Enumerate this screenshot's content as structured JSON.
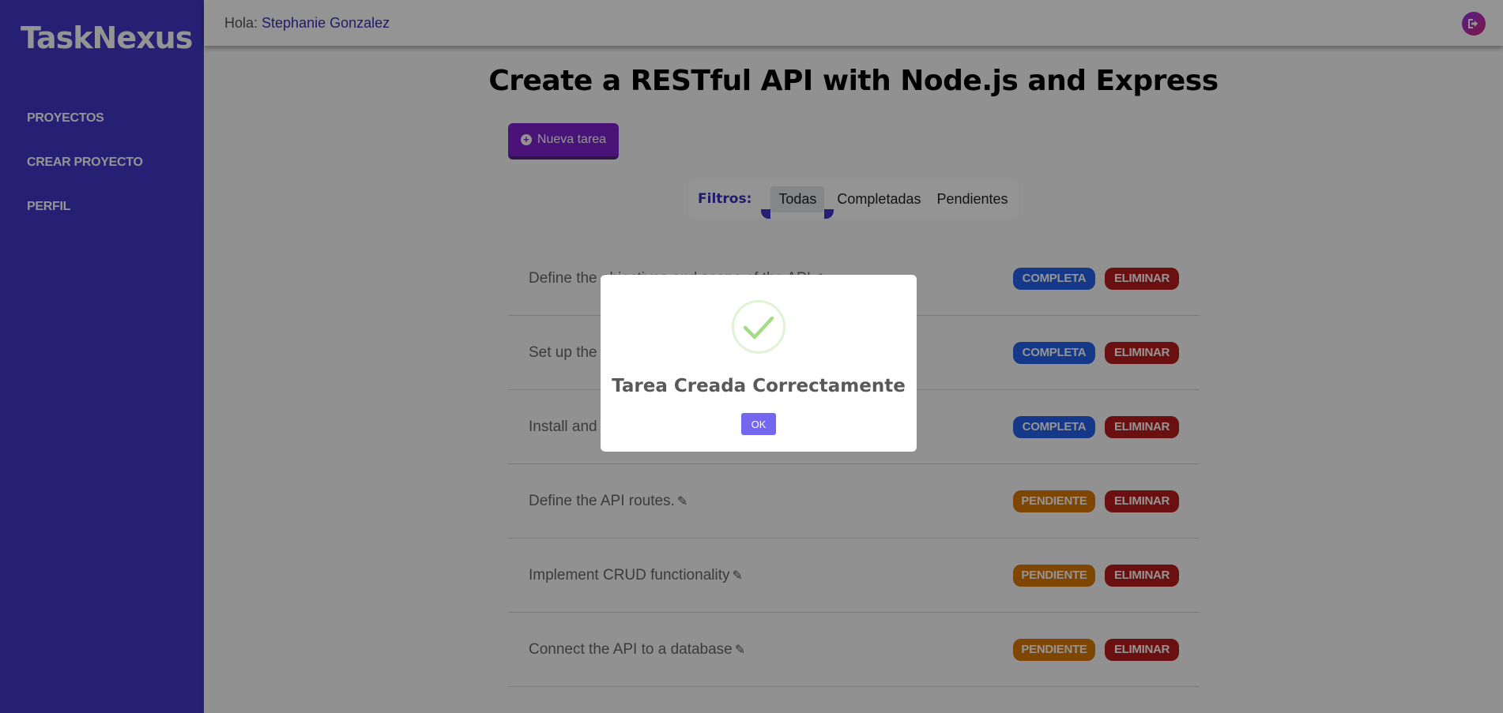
{
  "sidebar": {
    "brand": "TaskNexus",
    "items": [
      {
        "label": "PROYECTOS"
      },
      {
        "label": "CREAR PROYECTO"
      },
      {
        "label": "PERFIL"
      }
    ]
  },
  "header": {
    "greeting": "Hola:",
    "user_name": "Stephanie Gonzalez",
    "logout_icon": "logout-icon"
  },
  "project": {
    "title": "Create a RESTful API with Node.js and Express",
    "new_task_label": "Nueva tarea"
  },
  "filters": {
    "label": "Filtros:",
    "options": [
      "Todas",
      "Completadas",
      "Pendientes"
    ],
    "active": "Todas"
  },
  "tasks": [
    {
      "name": "Define the objectives and scope of the API.",
      "status": "COMPLETA",
      "delete": "ELIMINAR"
    },
    {
      "name": "Set up the development environment.",
      "status": "COMPLETA",
      "delete": "ELIMINAR"
    },
    {
      "name": "Install and configure Express.",
      "status": "COMPLETA",
      "delete": "ELIMINAR"
    },
    {
      "name": "Define the API routes.",
      "status": "PENDIENTE",
      "delete": "ELIMINAR"
    },
    {
      "name": "Implement CRUD functionality",
      "status": "PENDIENTE",
      "delete": "ELIMINAR"
    },
    {
      "name": "Connect the API to a database",
      "status": "PENDIENTE",
      "delete": "ELIMINAR"
    }
  ],
  "modal": {
    "icon": "success-check-icon",
    "title": "Tarea Creada Correctamente",
    "ok_label": "OK"
  },
  "colors": {
    "sidebar": "#4338ca",
    "primary": "#7e22ce",
    "complete": "#2563eb",
    "pending": "#d97706",
    "delete": "#b91c1c",
    "ok_button": "#7367f0",
    "success": "#a5dc86"
  }
}
